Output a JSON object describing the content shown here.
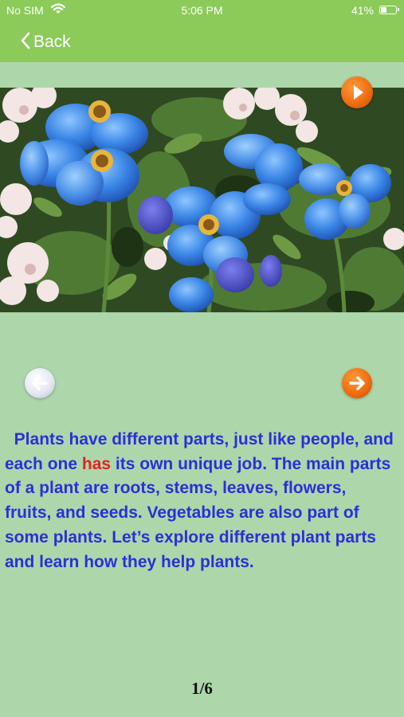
{
  "status_bar": {
    "carrier": "No SIM",
    "time": "5:06 PM",
    "battery_percent": "41%",
    "battery_level": 0.41,
    "wifi_icon": "wifi-icon"
  },
  "nav": {
    "back_label": "Back",
    "back_icon": "chevron-left-icon",
    "color": "#8cca59"
  },
  "media": {
    "image_icon": "flower-photo",
    "play_icon": "play-icon"
  },
  "navigation": {
    "prev_icon": "arrow-left-icon",
    "next_icon": "arrow-right-icon"
  },
  "story": {
    "segments": [
      {
        "text": "Plants have different parts, just like people, and each one ",
        "style": "normal"
      },
      {
        "text": "has",
        "style": "highlight"
      },
      {
        "text": " its own unique job. The main parts of a plant are roots, stems, leaves, flowers, fruits, and seeds. Vegetables are also part of some plants. Let’s explore different plant parts and learn how they help plants.",
        "style": "normal"
      }
    ],
    "text_color": "#2c2fd8",
    "highlight_color": "#e02222"
  },
  "page_indicator": "1/6",
  "colors": {
    "background": "#aed6ab",
    "accent_orange": "#f06e10"
  }
}
